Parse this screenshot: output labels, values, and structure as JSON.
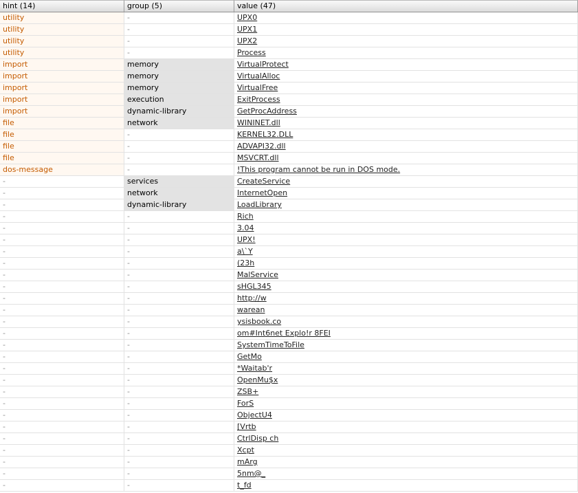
{
  "columns": {
    "hint": "hint (14)",
    "group": "group (5)",
    "value": "value (47)"
  },
  "rows": [
    {
      "hint": "utility",
      "group": "-",
      "value": "UPX0"
    },
    {
      "hint": "utility",
      "group": "-",
      "value": "UPX1"
    },
    {
      "hint": "utility",
      "group": "-",
      "value": "UPX2"
    },
    {
      "hint": "utility",
      "group": "-",
      "value": "Process"
    },
    {
      "hint": "import",
      "group": "memory",
      "value": "VirtualProtect"
    },
    {
      "hint": "import",
      "group": "memory",
      "value": "VirtualAlloc"
    },
    {
      "hint": "import",
      "group": "memory",
      "value": "VirtualFree"
    },
    {
      "hint": "import",
      "group": "execution",
      "value": "ExitProcess"
    },
    {
      "hint": "import",
      "group": "dynamic-library",
      "value": "GetProcAddress"
    },
    {
      "hint": "file",
      "group": "network",
      "value": "WININET.dll"
    },
    {
      "hint": "file",
      "group": "-",
      "value": "KERNEL32.DLL"
    },
    {
      "hint": "file",
      "group": "-",
      "value": "ADVAPI32.dll"
    },
    {
      "hint": "file",
      "group": "-",
      "value": "MSVCRT.dll"
    },
    {
      "hint": "dos-message",
      "group": "-",
      "value": "!This program cannot be run in DOS mode."
    },
    {
      "hint": "-",
      "group": "services",
      "value": "CreateService"
    },
    {
      "hint": "-",
      "group": "network",
      "value": "InternetOpen"
    },
    {
      "hint": "-",
      "group": "dynamic-library",
      "value": "LoadLibrary"
    },
    {
      "hint": "-",
      "group": "-",
      "value": "Rich"
    },
    {
      "hint": "-",
      "group": "-",
      "value": "3.04"
    },
    {
      "hint": "-",
      "group": "-",
      "value": "UPX!"
    },
    {
      "hint": "-",
      "group": "-",
      "value": "a\\`Y"
    },
    {
      "hint": "-",
      "group": "-",
      "value": "(23h"
    },
    {
      "hint": "-",
      "group": "-",
      "value": "MalService"
    },
    {
      "hint": "-",
      "group": "-",
      "value": "sHGL345"
    },
    {
      "hint": "-",
      "group": "-",
      "value": "http://w"
    },
    {
      "hint": "-",
      "group": "-",
      "value": "warean"
    },
    {
      "hint": "-",
      "group": "-",
      "value": "ysisbook.co"
    },
    {
      "hint": "-",
      "group": "-",
      "value": "om#Int6net Explo!r 8FEI"
    },
    {
      "hint": "-",
      "group": "-",
      "value": "SystemTimeToFile"
    },
    {
      "hint": "-",
      "group": "-",
      "value": "GetMo"
    },
    {
      "hint": "-",
      "group": "-",
      "value": "*Waitab'r"
    },
    {
      "hint": "-",
      "group": "-",
      "value": "OpenMu$x"
    },
    {
      "hint": "-",
      "group": "-",
      "value": "ZSB+"
    },
    {
      "hint": "-",
      "group": "-",
      "value": "ForS"
    },
    {
      "hint": "-",
      "group": "-",
      "value": "ObjectU4"
    },
    {
      "hint": "-",
      "group": "-",
      "value": "[Vrtb"
    },
    {
      "hint": "-",
      "group": "-",
      "value": "CtrlDisp ch"
    },
    {
      "hint": "-",
      "group": "-",
      "value": "Xcpt"
    },
    {
      "hint": "-",
      "group": "-",
      "value": "mArg"
    },
    {
      "hint": "-",
      "group": "-",
      "value": "5nm@_"
    },
    {
      "hint": "-",
      "group": "-",
      "value": "t_fd"
    }
  ]
}
